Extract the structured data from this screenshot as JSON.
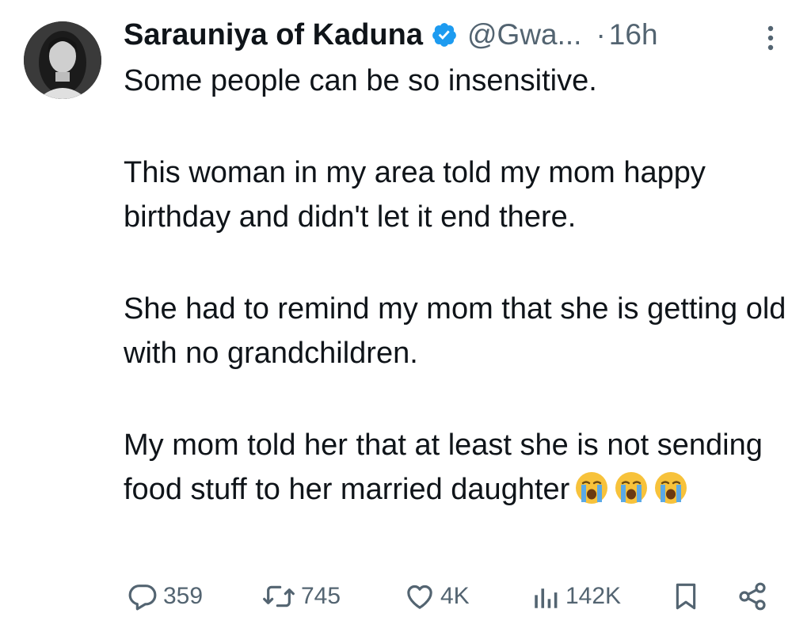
{
  "author": {
    "display_name": "Sarauniya of Kaduna",
    "handle": "@Gwa...",
    "separator": "·",
    "time": "16h",
    "verified": true
  },
  "tweet": {
    "paragraphs": [
      "Some people can be so insensitive.",
      "This woman in my area told my mom happy birthday and didn't let it end there.",
      "She had to remind my mom that she is getting old with no grandchildren.",
      "My mom told her that at least she is not sending food stuff to her married daughter"
    ],
    "trailing_emoji": [
      "loudly-crying-face",
      "loudly-crying-face",
      "loudly-crying-face"
    ]
  },
  "actions": {
    "replies": "359",
    "reposts": "745",
    "likes": "4K",
    "views": "142K"
  },
  "colors": {
    "text": "#0f1419",
    "secondary": "#536471",
    "verified": "#1d9bf0",
    "emoji_face": "#f7c23b",
    "emoji_tears": "#5aa9e6"
  }
}
